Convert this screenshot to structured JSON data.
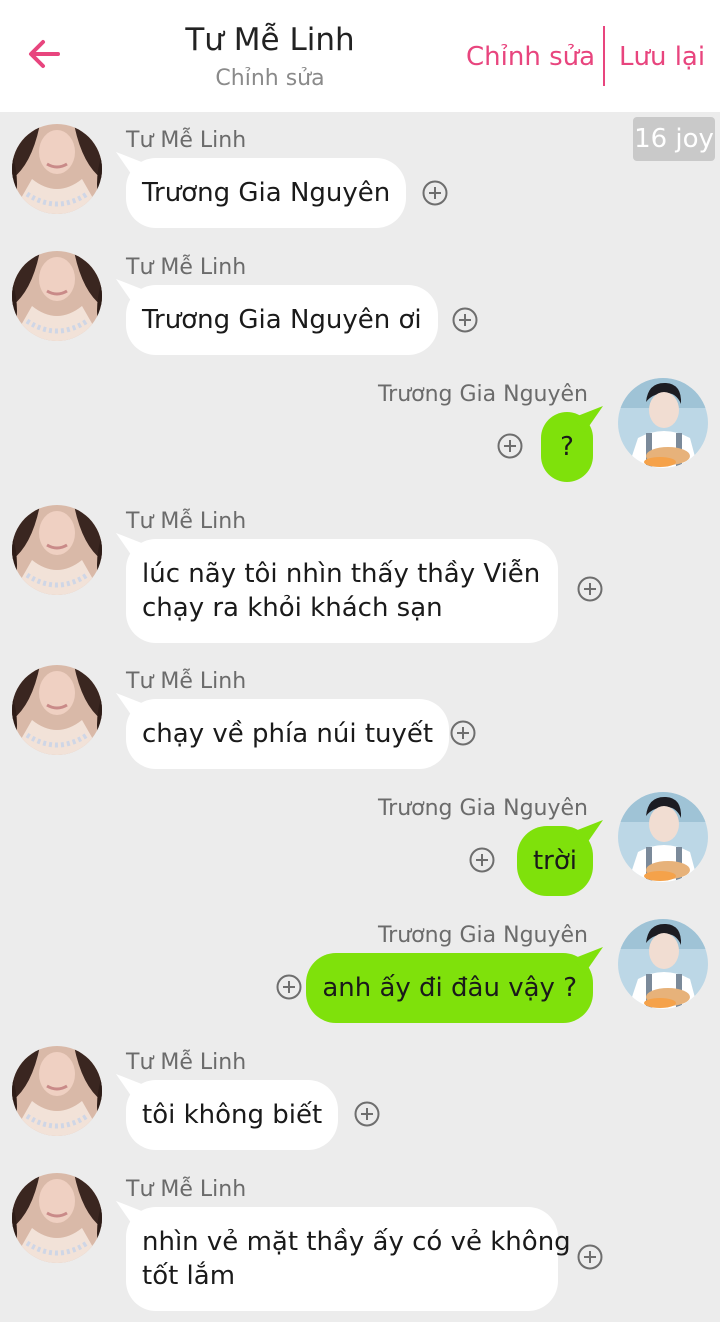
{
  "header": {
    "title": "Tư Mễ Linh",
    "subtitle": "Chỉnh sửa",
    "edit_label": "Chỉnh sửa",
    "save_label": "Lưu lại",
    "back_icon": "arrow-left-icon",
    "accent_color": "#e8457e"
  },
  "badge": "16 joy",
  "colors": {
    "incoming_bubble": "#ffffff",
    "outgoing_bubble": "#7fe10b",
    "background": "#ececec"
  },
  "messages": [
    {
      "sender": "Tư Mễ Linh",
      "side": "left",
      "lines": [
        "Trương Gia Nguyên"
      ]
    },
    {
      "sender": "Tư Mễ Linh",
      "side": "left",
      "lines": [
        "Trương Gia Nguyên ơi"
      ]
    },
    {
      "sender": "Trương Gia Nguyên",
      "side": "right",
      "lines": [
        "?"
      ]
    },
    {
      "sender": "Tư Mễ Linh",
      "side": "left",
      "lines": [
        "lúc nãy tôi nhìn thấy thầy Viễn",
        "chạy ra khỏi khách sạn"
      ]
    },
    {
      "sender": "Tư Mễ Linh",
      "side": "left",
      "lines": [
        "chạy về phía núi tuyết"
      ]
    },
    {
      "sender": "Trương Gia Nguyên",
      "side": "right",
      "lines": [
        "trời"
      ]
    },
    {
      "sender": "Trương Gia Nguyên",
      "side": "right",
      "lines": [
        "anh ấy đi đâu vậy ?"
      ]
    },
    {
      "sender": "Tư Mễ Linh",
      "side": "left",
      "lines": [
        "tôi không biết"
      ]
    },
    {
      "sender": "Tư Mễ Linh",
      "side": "left",
      "lines": [
        "nhìn vẻ mặt thầy ấy có vẻ không",
        "tốt lắm"
      ]
    }
  ]
}
